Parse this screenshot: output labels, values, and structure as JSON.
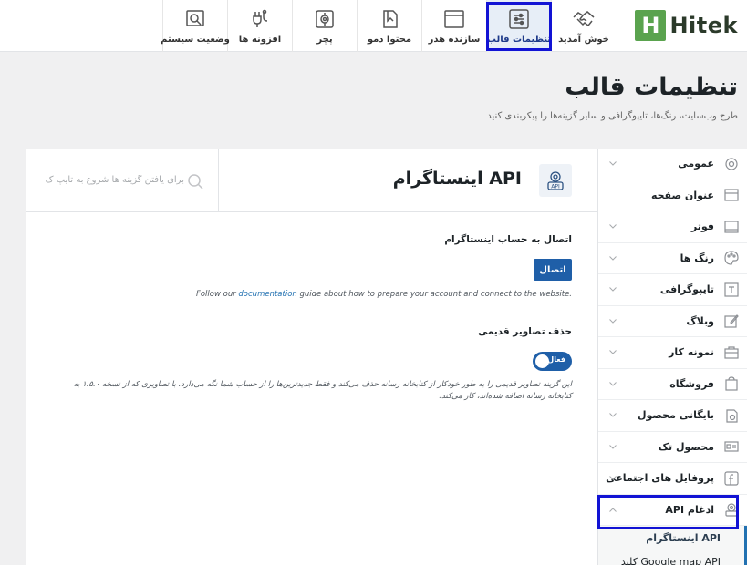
{
  "brand": {
    "letter": "H",
    "name": "Hitek",
    "color": "#5aa34e"
  },
  "tabs": [
    {
      "label": "خوش آمدید",
      "icon": "handshake-icon"
    },
    {
      "label": "تنظیمات قالب",
      "icon": "sliders-icon",
      "active": true
    },
    {
      "label": "سازنده هدر",
      "icon": "window-icon"
    },
    {
      "label": "محتوا دمو",
      "icon": "import-icon"
    },
    {
      "label": "پچر",
      "icon": "patch-icon"
    },
    {
      "label": "افزونه ها",
      "icon": "plug-icon"
    },
    {
      "label": "وضعیت سیستم",
      "icon": "system-status-icon"
    }
  ],
  "page": {
    "title": "تنظیمات قالب",
    "subtitle": "طرح وب‌سایت، رنگ‌ها، تایپوگرافی و سایر گزینه‌ها را پیکربندی کنید"
  },
  "sidebar": {
    "items": [
      {
        "label": "عمومی",
        "icon": "gear-icon",
        "expandable": true
      },
      {
        "label": "عنوان صفحه",
        "icon": "title-bar-icon",
        "expandable": false
      },
      {
        "label": "فوتر",
        "icon": "footer-icon",
        "expandable": true
      },
      {
        "label": "رنگ ها",
        "icon": "palette-icon",
        "expandable": true
      },
      {
        "label": "تایپوگرافی",
        "icon": "typography-icon",
        "expandable": true
      },
      {
        "label": "وبلاگ",
        "icon": "blog-icon",
        "expandable": true
      },
      {
        "label": "نمونه کار",
        "icon": "briefcase-icon",
        "expandable": true
      },
      {
        "label": "فروشگاه",
        "icon": "shopping-bag-icon",
        "expandable": true
      },
      {
        "label": "بایگانی محصول",
        "icon": "archive-icon",
        "expandable": true
      },
      {
        "label": "محصول تک",
        "icon": "product-card-icon",
        "expandable": true
      },
      {
        "label": "پروفایل های اجتماعی",
        "icon": "social-icon",
        "expandable": true
      },
      {
        "label": "ادغام API",
        "icon": "api-integration-icon",
        "expandable": true,
        "expanded": true
      }
    ],
    "sub_items": [
      {
        "label": "API اینستاگرام",
        "current": true
      },
      {
        "label": "Google map API کلید"
      }
    ]
  },
  "panel": {
    "title": "API اینستاگرام",
    "search_placeholder": "برای یافتن گزینه ها شروع به تایپ ک",
    "connect_section": {
      "title": "اتصال به حساب اینستاگرام",
      "button": "اتصال",
      "help_prefix": "Follow our ",
      "help_link": "documentation",
      "help_suffix": " guide about how to prepare your account and connect to the website."
    },
    "remove_section": {
      "title": "حذف تصاویر قدیمی",
      "toggle_label": "فعال",
      "toggle_on": true,
      "description": "این گزینه تصاویر قدیمی را به طور خودکار از کتابخانه رسانه حذف می‌کند و فقط جدیدترین‌ها را از حساب شما نگه می‌دارد. با تصاویری که از نسخه ۱.۵.۰ به کتابخانه رسانه اضافه شده‌اند، کار می‌کند."
    }
  },
  "colors": {
    "accent": "#1f5fa8",
    "highlight_border": "#1213d4"
  }
}
